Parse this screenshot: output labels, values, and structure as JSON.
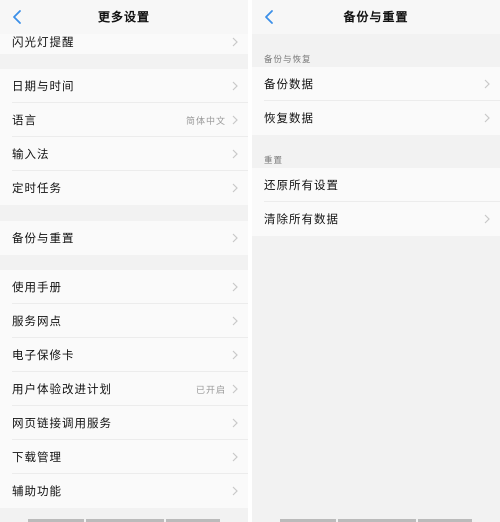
{
  "left": {
    "title": "更多设置",
    "items": [
      {
        "label": "闪光灯提醒",
        "value": ""
      },
      {
        "label": "日期与时间",
        "value": ""
      },
      {
        "label": "语言",
        "value": "简体中文"
      },
      {
        "label": "输入法",
        "value": ""
      },
      {
        "label": "定时任务",
        "value": ""
      },
      {
        "label": "备份与重置",
        "value": ""
      },
      {
        "label": "使用手册",
        "value": ""
      },
      {
        "label": "服务网点",
        "value": ""
      },
      {
        "label": "电子保修卡",
        "value": ""
      },
      {
        "label": "用户体验改进计划",
        "value": "已开启"
      },
      {
        "label": "网页链接调用服务",
        "value": ""
      },
      {
        "label": "下载管理",
        "value": ""
      },
      {
        "label": "辅助功能",
        "value": ""
      }
    ]
  },
  "right": {
    "title": "备份与重置",
    "sections": [
      {
        "header": "备份与恢复",
        "items": [
          {
            "label": "备份数据"
          },
          {
            "label": "恢复数据"
          }
        ]
      },
      {
        "header": "重置",
        "items": [
          {
            "label": "还原所有设置"
          },
          {
            "label": "清除所有数据"
          }
        ]
      }
    ]
  },
  "colors": {
    "accent": "#3b8fe8"
  }
}
